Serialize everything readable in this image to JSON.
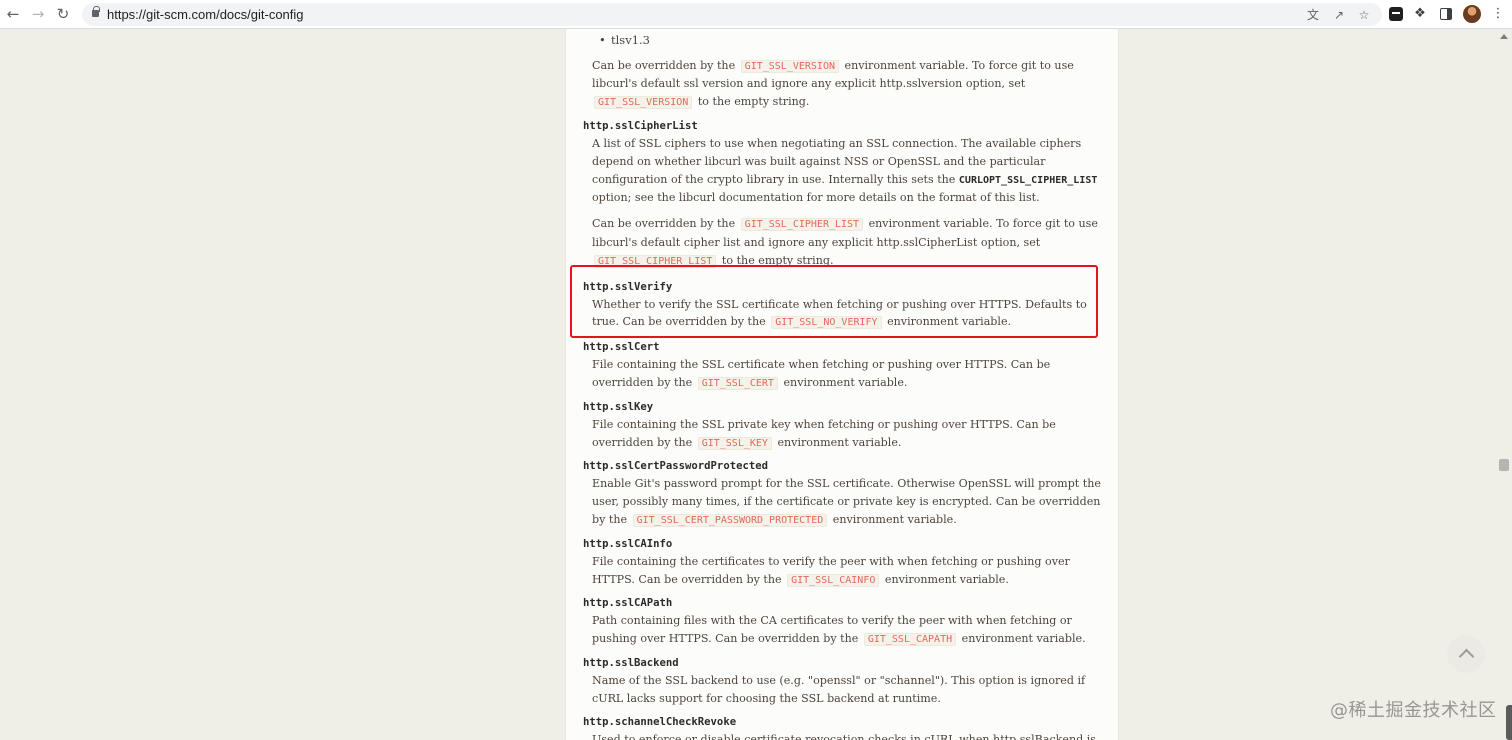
{
  "browser": {
    "url": "https://git-scm.com/docs/git-config"
  },
  "doc": {
    "bullet": "tlsv1.3",
    "sslversion_note": {
      "p1": "Can be overridden by the",
      "c1": "GIT_SSL_VERSION",
      "p2": "environment variable. To force git to use libcurl's default ssl version and ignore any explicit http.sslversion option, set",
      "c2": "GIT_SSL_VERSION",
      "p3": "to the empty string."
    },
    "cipher": {
      "term": "http.sslCipherList",
      "d1": "A list of SSL ciphers to use when negotiating an SSL connection. The available ciphers depend on whether libcurl was built against NSS or OpenSSL and the particular configuration of the crypto library in use. Internally this sets the",
      "d1_strong": "CURLOPT_SSL_CIPHER_LIST",
      "d1_end": "option; see the libcurl documentation for more details on the format of this list.",
      "n1": "Can be overridden by the",
      "c1": "GIT_SSL_CIPHER_LIST",
      "n2": "environment variable. To force git to use libcurl's default cipher list and ignore any explicit http.sslCipherList option, set",
      "c2": "GIT_SSL_CIPHER_LIST",
      "n3": "to the empty string."
    },
    "verify": {
      "term": "http.sslVerify",
      "d1": "Whether to verify the SSL certificate when fetching or pushing over HTTPS. Defaults to true. Can be overridden by the",
      "c1": "GIT_SSL_NO_VERIFY",
      "d2": "environment variable."
    },
    "cert": {
      "term": "http.sslCert",
      "d1": "File containing the SSL certificate when fetching or pushing over HTTPS. Can be overridden by the",
      "c1": "GIT_SSL_CERT",
      "d2": "environment variable."
    },
    "key": {
      "term": "http.sslKey",
      "d1": "File containing the SSL private key when fetching or pushing over HTTPS. Can be overridden by the",
      "c1": "GIT_SSL_KEY",
      "d2": "environment variable."
    },
    "certpw": {
      "term": "http.sslCertPasswordProtected",
      "d1": "Enable Git's password prompt for the SSL certificate. Otherwise OpenSSL will prompt the user, possibly many times, if the certificate or private key is encrypted. Can be overridden by the",
      "c1": "GIT_SSL_CERT_PASSWORD_PROTECTED",
      "d2": "environment variable."
    },
    "cainfo": {
      "term": "http.sslCAInfo",
      "d1": "File containing the certificates to verify the peer with when fetching or pushing over HTTPS. Can be overridden by the",
      "c1": "GIT_SSL_CAINFO",
      "d2": "environment variable."
    },
    "capath": {
      "term": "http.sslCAPath",
      "d1": "Path containing files with the CA certificates to verify the peer with when fetching or pushing over HTTPS. Can be overridden by the",
      "c1": "GIT_SSL_CAPATH",
      "d2": "environment variable."
    },
    "backend": {
      "term": "http.sslBackend",
      "d1": "Name of the SSL backend to use (e.g. \"openssl\" or \"schannel\"). This option is ignored if cURL lacks support for choosing the SSL backend at runtime."
    },
    "schannel": {
      "term": "http.schannelCheckRevoke",
      "d1": "Used to enforce or disable certificate revocation checks in cURL when http.sslBackend is set to"
    }
  },
  "watermark": "@稀土掘金技术社区"
}
